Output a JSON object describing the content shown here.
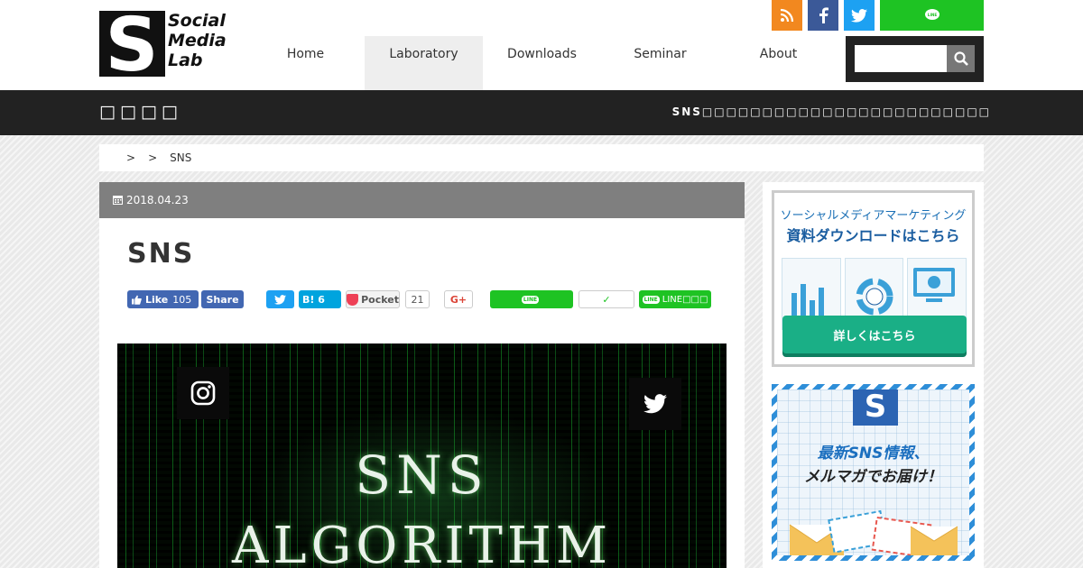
{
  "brand": {
    "logo_letter": "S",
    "logo_lines": [
      "Social",
      "Media",
      "Lab"
    ]
  },
  "nav": {
    "items": [
      {
        "label": "Home",
        "active": false
      },
      {
        "label": "Laboratory",
        "active": true
      },
      {
        "label": "Downloads",
        "active": false
      },
      {
        "label": "Seminar",
        "active": false
      },
      {
        "label": "About",
        "active": false
      }
    ]
  },
  "social_icons": [
    "rss-icon",
    "facebook-icon",
    "twitter-icon",
    "line-icon"
  ],
  "search": {
    "value": "",
    "placeholder": ""
  },
  "darkbar": {
    "title": "□□□□",
    "tagline": "SNS□□□□□□□□□□□□□□□□□□□□□□□□"
  },
  "breadcrumb": {
    "sep1": ">",
    "sep2": ">",
    "current": "SNS"
  },
  "article": {
    "date": "2018.04.23",
    "title": "SNS",
    "share": {
      "fb_like": "Like",
      "fb_like_count": "105",
      "fb_share": "Share",
      "hatena_label": "B!",
      "hatena_count": "6",
      "pocket": "Pocket",
      "pocket_count": "21",
      "gplus": "G+",
      "line_badge": "LINE",
      "check": "✓",
      "line2_label": "LINE□□□"
    },
    "hero": {
      "line1": "SNS",
      "line2": "ALGORITHM"
    }
  },
  "sidebar": {
    "banner1": {
      "line1": "ソーシャルメディアマーケティング",
      "line2": "資料ダウンロードはこちら",
      "button": "詳しくはこちら"
    },
    "banner2": {
      "line1": "最新SNS情報、",
      "line2": "メルマガでお届け！"
    }
  },
  "colors": {
    "rss": "#f2881f",
    "facebook": "#3b5998",
    "twitter": "#1da1f2",
    "line": "#1ec323",
    "darkbar": "#222222",
    "date_bar": "#7f7f7f"
  }
}
